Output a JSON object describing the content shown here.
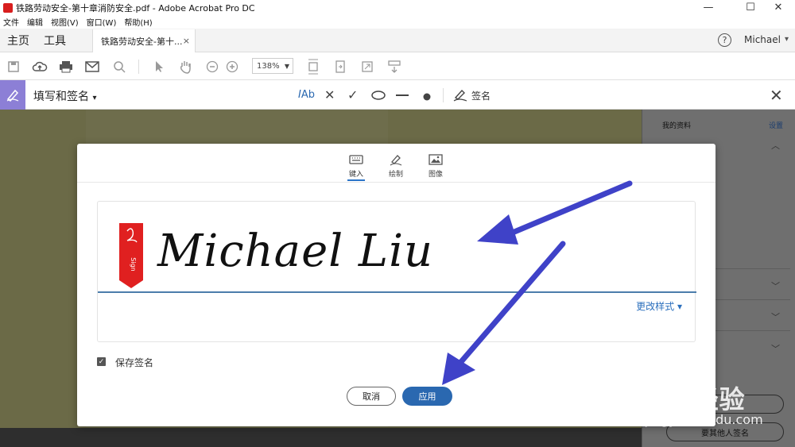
{
  "window": {
    "title": "铁路劳动安全-第十章消防安全.pdf - Adobe Acrobat Pro DC",
    "minimize": "—",
    "maximize": "☐",
    "close": "✕"
  },
  "menu": [
    "文件",
    "编辑",
    "视图(V)",
    "窗口(W)",
    "帮助(H)"
  ],
  "tabs": {
    "home": "主页",
    "tools": "工具",
    "document": "铁路劳动安全-第十...",
    "document_close": "×"
  },
  "user": {
    "help": "?",
    "name": "Michael",
    "arrow": "▾"
  },
  "toolbar": {
    "zoom": "138%"
  },
  "fill_sign": {
    "label": "填写和签名",
    "text_tool": "Ab",
    "sign_label": "签名"
  },
  "right_panel": {
    "my_profile": "我的资料",
    "settings": "设置",
    "button1": "",
    "button2": "要其他人签名"
  },
  "modal": {
    "tabs": [
      {
        "label": "键入",
        "icon": "keyboard-icon",
        "active": true
      },
      {
        "label": "绘制",
        "icon": "pen-draw-icon",
        "active": false
      },
      {
        "label": "图像",
        "icon": "image-icon",
        "active": false
      }
    ],
    "ribbon_text": "Sign",
    "signature_text": "Michael Liu",
    "change_style": "更改样式 ▾",
    "save_signature": "保存签名",
    "cancel": "取消",
    "apply": "应用"
  },
  "watermark": {
    "brand": "Baidu经验",
    "sub": "jingyan.baidu.com"
  },
  "colors": {
    "accent": "#2a68b0",
    "fill_sign_icon": "#8c7fd6",
    "arrow": "#3f42c8",
    "doc_bg": "#6b6a47"
  }
}
